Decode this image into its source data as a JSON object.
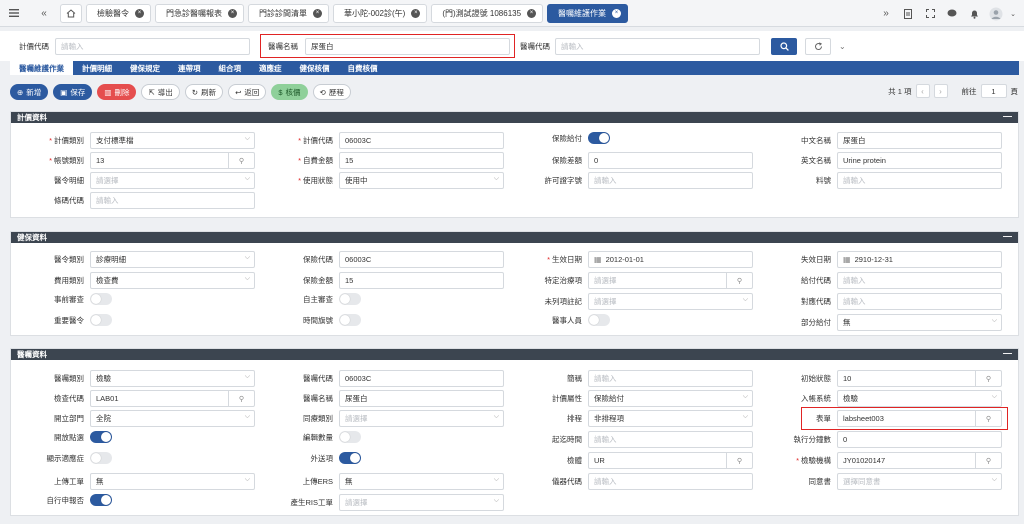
{
  "tabs": [
    {
      "label": "檢驗醫令",
      "active": false
    },
    {
      "label": "門急診醫囑報表",
      "active": false
    },
    {
      "label": "門診診間清單",
      "active": false
    },
    {
      "label": "華小陀-002診(午)",
      "active": false
    },
    {
      "label": "(門)測試證號 1086135",
      "active": false
    },
    {
      "label": "醫囑維護作業",
      "active": true
    }
  ],
  "search": {
    "billing_code_label": "計價代碼",
    "billing_code_placeholder": "請輸入",
    "order_name_label": "醫囑名稱",
    "order_name_value": "尿蛋白",
    "order_code_label": "醫囑代碼",
    "order_code_placeholder": "請輸入"
  },
  "nav": [
    "醫囑維護作業",
    "計價明細",
    "健保規定",
    "連帶項",
    "組合項",
    "適應症",
    "健保核價",
    "自費核價"
  ],
  "toolbar": [
    "新增",
    "保存",
    "刪除",
    "導出",
    "刷新",
    "返回",
    "核價",
    "歷程"
  ],
  "pager": {
    "total": "共 1 項",
    "goto": "前往",
    "page": "1",
    "unit": "頁"
  },
  "sections": {
    "billing": {
      "title": "計價資料",
      "price_type_label": "計價類別",
      "price_type_value": "支付標準檔",
      "price_code_label": "計價代碼",
      "price_code_value": "06003C",
      "insurance_pay_label": "保險給付",
      "cn_name_label": "中文名稱",
      "cn_name_value": "尿蛋白",
      "account_type_label": "帳號類別",
      "account_type_value": "13",
      "self_amount_label": "自費金額",
      "self_amount_value": "15",
      "insurance_diff_label": "保險差額",
      "insurance_diff_value": "0",
      "en_name_label": "英文名稱",
      "en_name_value": "Urine protein",
      "order_detail_label": "醫令明細",
      "order_detail_placeholder": "請選擇",
      "use_status_label": "使用狀態",
      "use_status_value": "使用中",
      "license_label": "許可證字號",
      "license_placeholder": "請輸入",
      "material_label": "料號",
      "material_placeholder": "請輸入",
      "barcode_label": "條碼代碼",
      "barcode_placeholder": "請輸入"
    },
    "insurance": {
      "title": "健保資料",
      "order_type_label": "醫令類別",
      "order_type_value": "診療明細",
      "ins_code_label": "保險代碼",
      "ins_code_value": "06003C",
      "effective_label": "生效日期",
      "effective_value": "2012-01-01",
      "expire_label": "失效日期",
      "expire_value": "2910-12-31",
      "fee_type_label": "費用類別",
      "fee_type_value": "檢查費",
      "ins_amount_label": "保險金額",
      "ins_amount_value": "15",
      "special_label": "特定治療項",
      "special_placeholder": "請選擇",
      "pay_code_label": "給付代碼",
      "pay_code_placeholder": "請輸入",
      "prior_review_label": "事前審查",
      "self_review_label": "自主審查",
      "unlisted_label": "未列項註記",
      "unlisted_placeholder": "請選擇",
      "map_code_label": "對應代碼",
      "map_code_placeholder": "請輸入",
      "repeat_label": "重要醫令",
      "time_label": "時間旗號",
      "doctor_label": "醫事人員",
      "partial_label": "部分給付",
      "partial_value": "無"
    },
    "order": {
      "title": "醫囑資料",
      "type_label": "醫囑類別",
      "type_value": "檢驗",
      "code_label": "醫囑代碼",
      "code_value": "06003C",
      "short_label": "簡稱",
      "short_placeholder": "請輸入",
      "init_label": "初始狀態",
      "init_value": "10",
      "check_code_label": "檢查代碼",
      "check_code_value": "LAB01",
      "name_label": "醫囑名稱",
      "name_value": "尿蛋白",
      "attr_label": "計價屬性",
      "attr_value": "保險給付",
      "account_label": "入帳系統",
      "account_value": "檢驗",
      "dept_label": "開立部門",
      "dept_value": "全院",
      "same_type_label": "同療類別",
      "same_type_placeholder": "請選擇",
      "schedule_label": "排程",
      "schedule_value": "非排程項",
      "form_label": "表單",
      "form_value": "labsheet003",
      "open_label": "開放點選",
      "edit_label": "編輯數量",
      "start_label": "起迄時間",
      "start_placeholder": "請輸入",
      "exec_label": "執行分鐘數",
      "exec_value": "0",
      "indication_label": "顯示適應症",
      "outsource_label": "外送項",
      "specimen_label": "檢體",
      "specimen_value": "UR",
      "lab_org_label": "檢驗機構",
      "lab_org_value": "JY01020147",
      "upload_label": "上傳工單",
      "upload_value": "無",
      "ers_label": "上傳ERS",
      "ers_value": "無",
      "device_label": "儀器代碼",
      "device_placeholder": "請輸入",
      "consent_label": "同意書",
      "consent_placeholder": "選擇同意書",
      "auto_label": "自行申報否",
      "ris_label": "產生RIS工單",
      "ris_placeholder": "請選擇"
    }
  },
  "colors": {
    "primary": "#2c5aa0",
    "header": "#3c4550",
    "highlight": "#e02424"
  }
}
